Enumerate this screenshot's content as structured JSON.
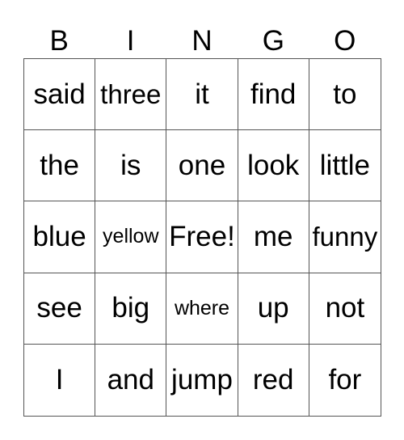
{
  "header": [
    "B",
    "I",
    "N",
    "G",
    "O"
  ],
  "rows": [
    [
      "said",
      "three",
      "it",
      "find",
      "to"
    ],
    [
      "the",
      "is",
      "one",
      "look",
      "little"
    ],
    [
      "blue",
      "yellow",
      "Free!",
      "me",
      "funny"
    ],
    [
      "see",
      "big",
      "where",
      "up",
      "not"
    ],
    [
      "I",
      "and",
      "jump",
      "red",
      "for"
    ]
  ]
}
